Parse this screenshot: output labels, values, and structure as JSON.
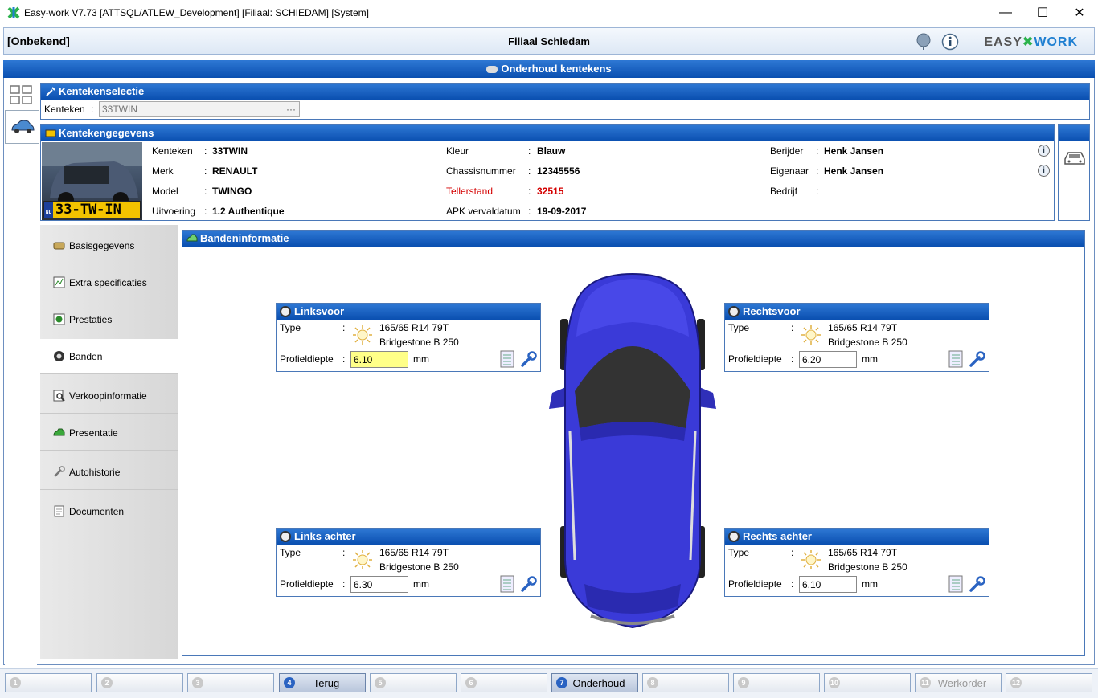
{
  "window": {
    "title": "Easy-work V7.73 [ATTSQL/ATLEW_Development] [Filiaal: SCHIEDAM] [System]",
    "min": "—",
    "max": "☐",
    "close": "✕"
  },
  "header": {
    "user": "[Onbekend]",
    "branch": "Filiaal Schiedam",
    "logo_left": "EASY",
    "logo_right": "WORK"
  },
  "main_title": "Onderhoud kentekens",
  "selection": {
    "title": "Kentekenselectie",
    "label": "Kenteken",
    "colon": ":",
    "value": "33TWIN",
    "ellipsis": "···"
  },
  "vehicle": {
    "title": "Kentekengegevens",
    "plate": "33-TW-IN",
    "plate_country": "NL",
    "fields": [
      {
        "label": "Kenteken",
        "value": "33TWIN"
      },
      {
        "label": "Merk",
        "value": "RENAULT"
      },
      {
        "label": "Model",
        "value": "TWINGO"
      },
      {
        "label": "Uitvoering",
        "value": "1.2 Authentique"
      },
      {
        "label": "Kleur",
        "value": "Blauw"
      },
      {
        "label": "Chassisnummer",
        "value": "12345556"
      },
      {
        "label": "Tellerstand",
        "value": "32515"
      },
      {
        "label": "APK vervaldatum",
        "value": "19-09-2017"
      },
      {
        "label": "Berijder",
        "value": "Henk Jansen"
      },
      {
        "label": "Eigenaar",
        "value": "Henk Jansen"
      },
      {
        "label": "Bedrijf",
        "value": ""
      }
    ]
  },
  "nav": [
    {
      "label": "Basisgegevens",
      "icon": "stack-icon"
    },
    {
      "label": "Extra specificaties",
      "icon": "chart-icon"
    },
    {
      "label": "Prestaties",
      "icon": "gauge-icon"
    },
    {
      "label": "Banden",
      "icon": "tire-icon"
    },
    {
      "label": "Verkoopinformatie",
      "icon": "magnifier-icon"
    },
    {
      "label": "Presentatie",
      "icon": "car-icon"
    },
    {
      "label": "Autohistorie",
      "icon": "wrench-icon"
    },
    {
      "label": "Documenten",
      "icon": "document-icon"
    }
  ],
  "tires_panel": {
    "title": "Bandeninformatie",
    "type_label": "Type",
    "depth_label": "Profieldiepte",
    "colon": ":",
    "unit": "mm",
    "tires": [
      {
        "title": "Linksvoor",
        "size": "165/65 R14 79T",
        "brand": "Bridgestone B 250",
        "depth": "6.10"
      },
      {
        "title": "Rechtsvoor",
        "size": "165/65 R14 79T",
        "brand": "Bridgestone B 250",
        "depth": "6.20"
      },
      {
        "title": "Links achter",
        "size": "165/65 R14 79T",
        "brand": "Bridgestone B 250",
        "depth": "6.30"
      },
      {
        "title": "Rechts achter",
        "size": "165/65 R14 79T",
        "brand": "Bridgestone B 250",
        "depth": "6.10"
      }
    ]
  },
  "footer": [
    {
      "num": "1",
      "label": ""
    },
    {
      "num": "2",
      "label": ""
    },
    {
      "num": "3",
      "label": ""
    },
    {
      "num": "4",
      "label": "Terug"
    },
    {
      "num": "5",
      "label": ""
    },
    {
      "num": "6",
      "label": ""
    },
    {
      "num": "7",
      "label": "Onderhoud"
    },
    {
      "num": "8",
      "label": ""
    },
    {
      "num": "9",
      "label": ""
    },
    {
      "num": "10",
      "label": ""
    },
    {
      "num": "11",
      "label": "Werkorder"
    },
    {
      "num": "12",
      "label": ""
    }
  ],
  "colors": {
    "accent": "#0a4fb0",
    "car": "#3a3ad8",
    "highlight": "#ffff88",
    "warning": "#d40000"
  }
}
